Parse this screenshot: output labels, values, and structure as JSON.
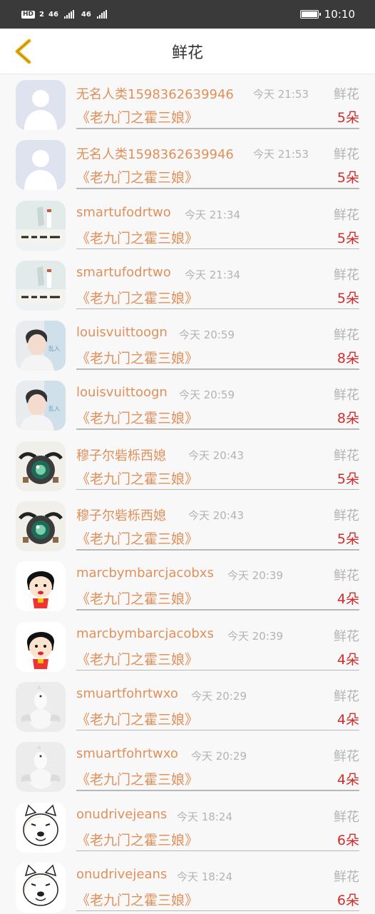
{
  "status_bar": {
    "hd": "HD",
    "sim": "2",
    "net1": "46",
    "net2": "46",
    "time": "10:10"
  },
  "header": {
    "title": "鲜花"
  },
  "colors": {
    "accent": "#e0905a",
    "quantity": "#d32c2c",
    "muted": "#b3b3b3"
  },
  "records": [
    {
      "name": "无名人类1598362639946",
      "time": "今天 21:53",
      "gift": "鲜花",
      "play": "《老九门之霍三娘》",
      "qty": "5朵",
      "avatar": "default-avatar"
    },
    {
      "name": "无名人类1598362639946",
      "time": "今天 21:53",
      "gift": "鲜花",
      "play": "《老九门之霍三娘》",
      "qty": "5朵",
      "avatar": "default-avatar"
    },
    {
      "name": "smartufodrtwo",
      "time": "今天 21:34",
      "gift": "鲜花",
      "play": "《老九门之霍三娘》",
      "qty": "5朵",
      "avatar": "calligraphy-avatar"
    },
    {
      "name": "smartufodrtwo",
      "time": "今天 21:34",
      "gift": "鲜花",
      "play": "《老九门之霍三娘》",
      "qty": "5朵",
      "avatar": "calligraphy-avatar"
    },
    {
      "name": "louisvuittoogn",
      "time": "今天 20:59",
      "gift": "鲜花",
      "play": "《老九门之霍三娘》",
      "qty": "8朵",
      "avatar": "boy-avatar"
    },
    {
      "name": "louisvuittoogn",
      "time": "今天 20:59",
      "gift": "鲜花",
      "play": "《老九门之霍三娘》",
      "qty": "8朵",
      "avatar": "boy-avatar"
    },
    {
      "name": "穆子尔砦栎西媳",
      "time": "今天 20:43",
      "gift": "鲜花",
      "play": "《老九门之霍三娘》",
      "qty": "5朵",
      "avatar": "camera-avatar"
    },
    {
      "name": "穆子尔砦栎西媳",
      "time": "今天 20:43",
      "gift": "鲜花",
      "play": "《老九门之霍三娘》",
      "qty": "5朵",
      "avatar": "camera-avatar"
    },
    {
      "name": "marcbymbarcjacobxs",
      "time": "今天 20:39",
      "gift": "鲜花",
      "play": "《老九门之霍三娘》",
      "qty": "4朵",
      "avatar": "cartoon-avatar"
    },
    {
      "name": "marcbymbarcjacobxs",
      "time": "今天 20:39",
      "gift": "鲜花",
      "play": "《老九门之霍三娘》",
      "qty": "4朵",
      "avatar": "cartoon-avatar"
    },
    {
      "name": "smuartfohrtwxo",
      "time": "今天 20:29",
      "gift": "鲜花",
      "play": "《老九门之霍三娘》",
      "qty": "4朵",
      "avatar": "dog-flex-avatar"
    },
    {
      "name": "smuartfohrtwxo",
      "time": "今天 20:29",
      "gift": "鲜花",
      "play": "《老九门之霍三娘》",
      "qty": "4朵",
      "avatar": "dog-flex-avatar"
    },
    {
      "name": "onudrivejeans",
      "time": "今天 18:24",
      "gift": "鲜花",
      "play": "《老九门之霍三娘》",
      "qty": "6朵",
      "avatar": "doge-avatar"
    },
    {
      "name": "onudrivejeans",
      "time": "今天 18:24",
      "gift": "鲜花",
      "play": "《老九门之霍三娘》",
      "qty": "6朵",
      "avatar": "doge-avatar"
    }
  ]
}
